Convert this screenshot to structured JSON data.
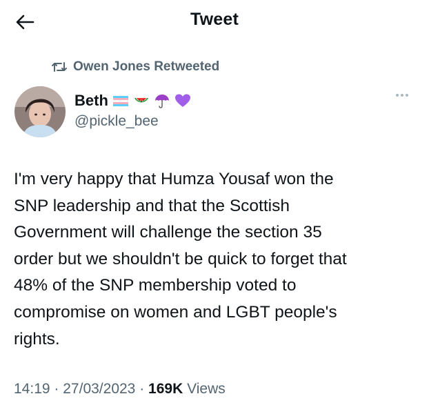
{
  "header": {
    "title": "Tweet"
  },
  "retweet": {
    "label": "Owen Jones Retweeted"
  },
  "author": {
    "name": "Beth",
    "handle": "@pickle_bee"
  },
  "tweet": {
    "lines": [
      "I'm very happy that Humza Yousaf won the",
      "SNP leadership and that the Scottish",
      "Government will challenge the section 35",
      "order but we shouldn't be quick to forget that",
      "48% of the SNP membership voted to",
      "compromise on women and LGBT people's",
      "rights."
    ],
    "time": "14:19",
    "sep1": "·",
    "date": "27/03/2023",
    "sep2": "·",
    "views_count": "169K",
    "views_label": "Views"
  },
  "icons": {
    "back": "back-arrow-icon",
    "retweet": "retweet-icon",
    "more": "more-options-icon",
    "name_emojis": [
      "transgender-flag-icon",
      "watermelon-icon",
      "umbrella-icon",
      "purple-heart-icon"
    ]
  },
  "colors": {
    "text": "#0f1419",
    "secondary": "#536471",
    "heart": "#a15ee8"
  }
}
